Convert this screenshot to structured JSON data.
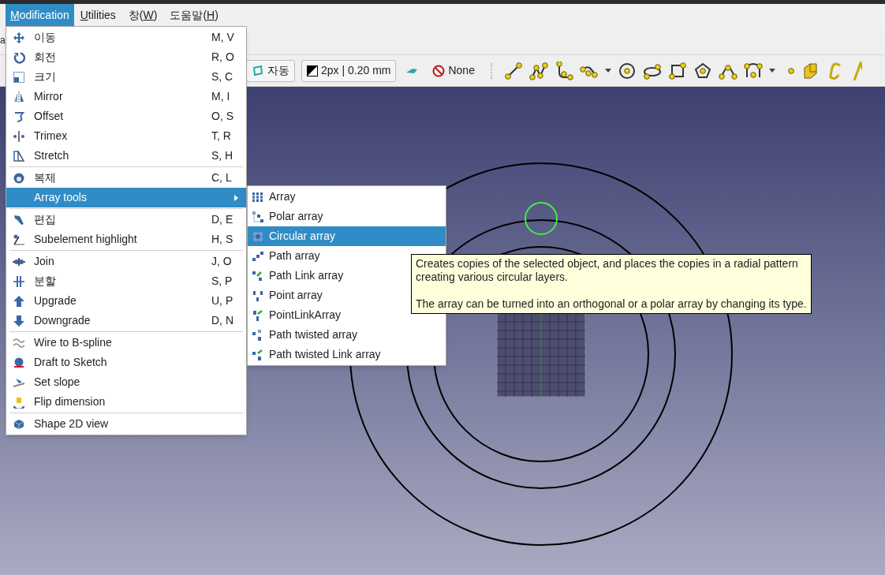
{
  "menubar": [
    {
      "key": "M",
      "after": "odification",
      "selected": true
    },
    {
      "key": "U",
      "after": "tilities",
      "selected": false
    },
    {
      "before": "창(",
      "key": "W",
      "after": ")",
      "selected": false
    },
    {
      "before": "도움말(",
      "key": "H",
      "after": ")",
      "selected": false
    }
  ],
  "toolbar_fragment": "a",
  "toolbar": {
    "buttons": [
      {
        "kind": "button",
        "label": "자동"
      },
      {
        "kind": "button",
        "label": "2px | 0.20 mm"
      },
      {
        "kind": "flat",
        "label": "None"
      }
    ]
  },
  "menu": [
    {
      "kind": "item",
      "label": "이동",
      "shortcut": "M, V",
      "selected": false
    },
    {
      "kind": "item",
      "label": "회전",
      "shortcut": "R, O",
      "selected": false
    },
    {
      "kind": "item",
      "label": "크기",
      "shortcut": "S, C",
      "selected": false
    },
    {
      "kind": "item",
      "label": "Mirror",
      "shortcut": "M, I",
      "selected": false
    },
    {
      "kind": "item",
      "label": "Offset",
      "shortcut": "O, S",
      "selected": false
    },
    {
      "kind": "item",
      "label": "Trimex",
      "shortcut": "T, R",
      "selected": false
    },
    {
      "kind": "item",
      "label": "Stretch",
      "shortcut": "S, H",
      "selected": false
    },
    {
      "kind": "separator"
    },
    {
      "kind": "item",
      "label": "복제",
      "shortcut": "C, L",
      "selected": false
    },
    {
      "kind": "submenu",
      "label": "Array tools",
      "selected": true
    },
    {
      "kind": "separator"
    },
    {
      "kind": "item",
      "label": "편집",
      "shortcut": "D, E",
      "selected": false
    },
    {
      "kind": "item",
      "label": "Subelement highlight",
      "shortcut": "H, S",
      "selected": false
    },
    {
      "kind": "separator"
    },
    {
      "kind": "item",
      "label": "Join",
      "shortcut": "J, O",
      "selected": false
    },
    {
      "kind": "item",
      "label": "분할",
      "shortcut": "S, P",
      "selected": false
    },
    {
      "kind": "item",
      "label": "Upgrade",
      "shortcut": "U, P",
      "selected": false
    },
    {
      "kind": "item",
      "label": "Downgrade",
      "shortcut": "D, N",
      "selected": false
    },
    {
      "kind": "separator"
    },
    {
      "kind": "item",
      "label": "Wire to B-spline",
      "selected": false
    },
    {
      "kind": "item",
      "label": "Draft to Sketch",
      "selected": false
    },
    {
      "kind": "item",
      "label": "Set slope",
      "selected": false
    },
    {
      "kind": "item",
      "label": "Flip dimension",
      "selected": false
    },
    {
      "kind": "separator"
    },
    {
      "kind": "item",
      "label": "Shape 2D view",
      "selected": false
    }
  ],
  "submenu": [
    {
      "label": "Array",
      "selected": false
    },
    {
      "label": "Polar array",
      "selected": false
    },
    {
      "label": "Circular array",
      "selected": true
    },
    {
      "label": "Path array",
      "selected": false
    },
    {
      "label": "Path Link array",
      "selected": false
    },
    {
      "label": "Point array",
      "selected": false
    },
    {
      "label": "PointLinkArray",
      "selected": false
    },
    {
      "label": "Path twisted array",
      "selected": false
    },
    {
      "label": "Path twisted Link array",
      "selected": false
    }
  ],
  "tooltip": {
    "paragraphs": [
      [
        "Creates copies of the selected object, and places the copies in a radial pattern",
        "creating various circular layers."
      ],
      [
        "The array can be turned into an orthogonal or a polar array by changing its type."
      ]
    ]
  }
}
